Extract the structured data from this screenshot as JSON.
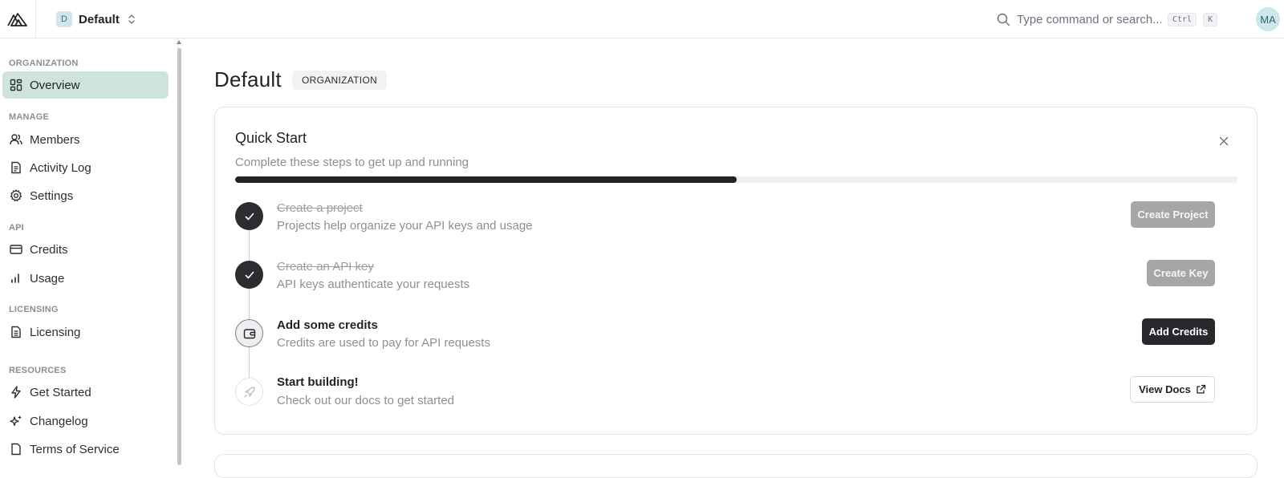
{
  "header": {
    "org_initial": "D",
    "org_name": "Default",
    "search_placeholder": "Type command or search...",
    "kbd_ctrl": "Ctrl",
    "kbd_k": "K",
    "user_initials": "MA"
  },
  "sidebar": {
    "sections": {
      "organization": "ORGANIZATION",
      "manage": "MANAGE",
      "api": "API",
      "licensing": "LICENSING",
      "resources": "RESOURCES"
    },
    "items": {
      "overview": "Overview",
      "members": "Members",
      "activity_log": "Activity Log",
      "settings": "Settings",
      "credits": "Credits",
      "usage": "Usage",
      "licensing": "Licensing",
      "get_started": "Get Started",
      "changelog": "Changelog",
      "terms": "Terms of Service"
    },
    "active_item": "Overview"
  },
  "main": {
    "title": "Default",
    "badge": "ORGANIZATION"
  },
  "quick_start": {
    "title": "Quick Start",
    "subtitle": "Complete these steps to get up and running",
    "progress_fraction": 0.5,
    "steps": [
      {
        "title": "Create a project",
        "description": "Projects help organize your API keys and usage",
        "button": "Create Project",
        "status": "done"
      },
      {
        "title": "Create an API key",
        "description": "API keys authenticate your requests",
        "button": "Create Key",
        "status": "done"
      },
      {
        "title": "Add some credits",
        "description": "Credits are used to pay for API requests",
        "button": "Add Credits",
        "status": "current"
      },
      {
        "title": "Start building!",
        "description": "Check out our docs to get started",
        "button": "View Docs",
        "status": "todo"
      }
    ]
  },
  "colors": {
    "accent_active_bg": "#cfe3dd",
    "avatar_bg": "#cfe6ec",
    "primary_dark": "#26282b",
    "disabled_button": "#a6a6a6"
  }
}
